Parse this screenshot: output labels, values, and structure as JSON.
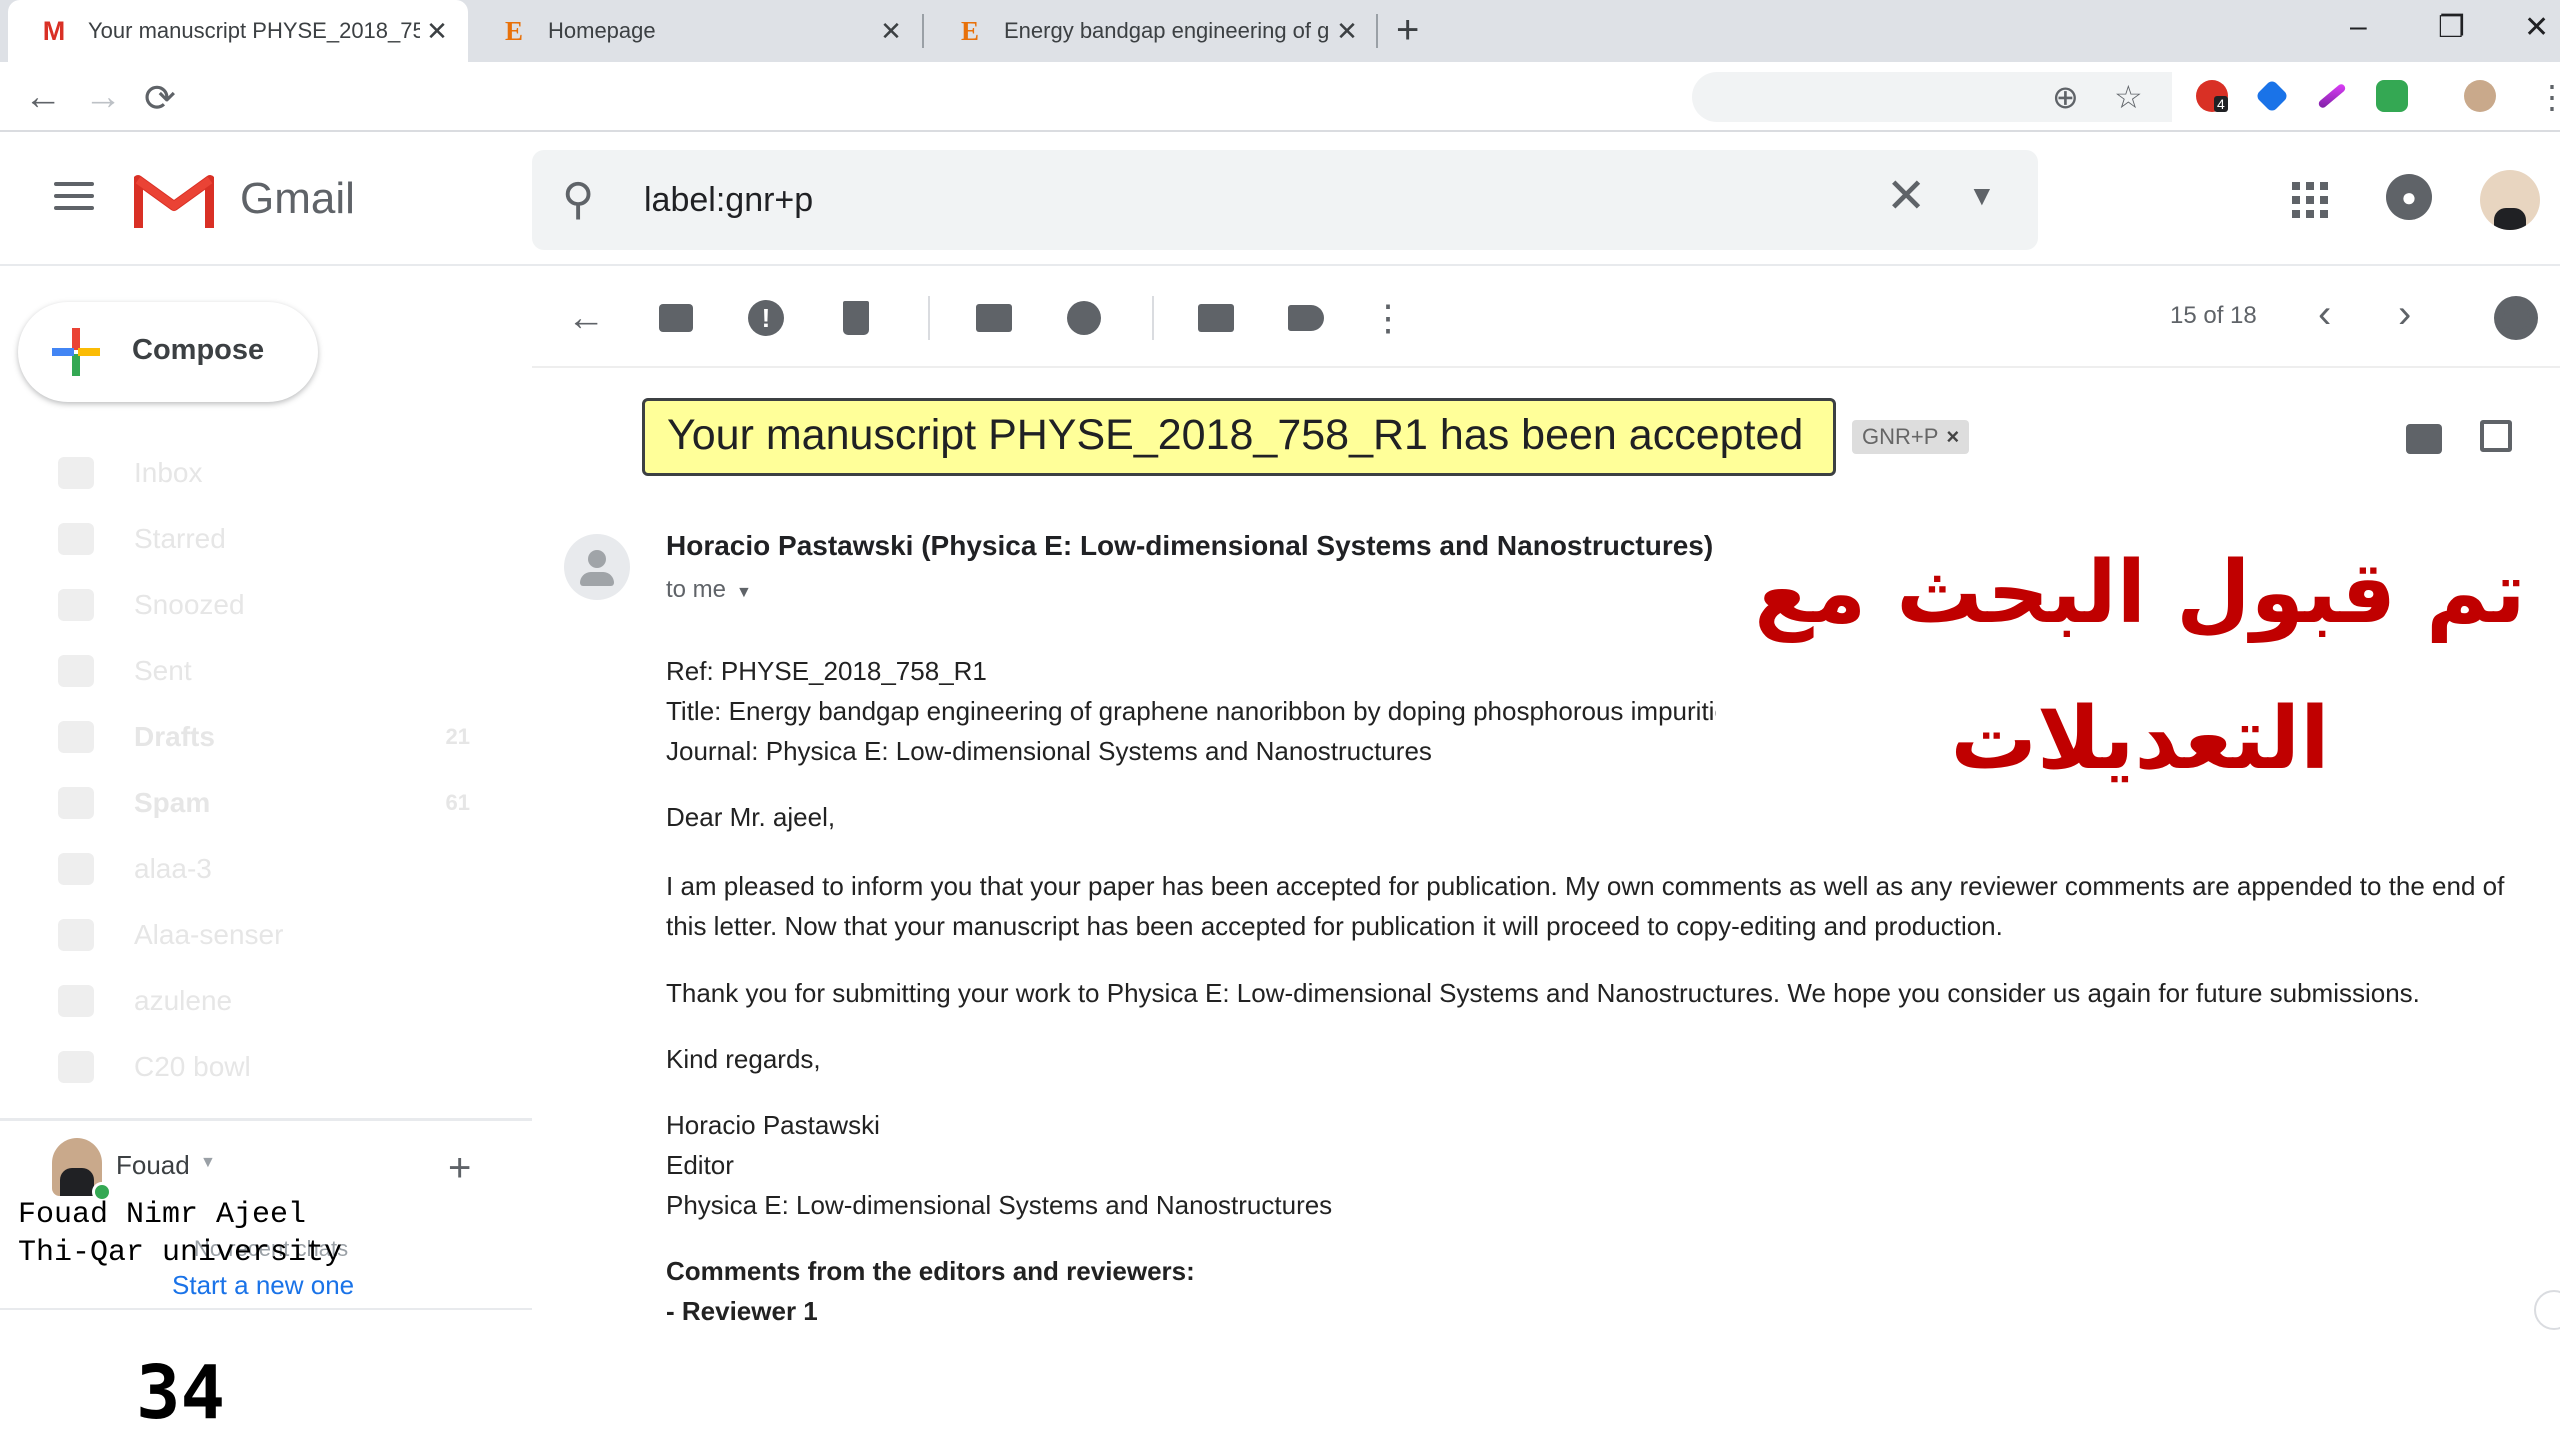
{
  "browser": {
    "tabs": [
      {
        "title": "Your manuscript PHYSE_2018_75",
        "favicon": "M",
        "active": true
      },
      {
        "title": "Homepage",
        "favicon": "E",
        "active": false
      },
      {
        "title": "Energy bandgap engineering of g",
        "favicon": "E",
        "active": false
      }
    ],
    "new_tab": "+",
    "window_controls": {
      "minimize": "–",
      "restore": "❐",
      "close": "✕"
    },
    "nav": {
      "back": "←",
      "forward": "→",
      "reload": "⟳"
    },
    "icons": [
      "zoom-icon",
      "star-icon",
      "extension-icons",
      "profile-icon",
      "menu-icon"
    ],
    "extension_badge": "4"
  },
  "header": {
    "app_name": "Gmail",
    "search": {
      "value": "label:gnr+p"
    }
  },
  "sidebar": {
    "compose_label": "Compose",
    "items": [
      {
        "label": "Inbox",
        "count": "",
        "bold": false
      },
      {
        "label": "Starred",
        "count": "",
        "bold": false
      },
      {
        "label": "Snoozed",
        "count": "",
        "bold": false
      },
      {
        "label": "Sent",
        "count": "",
        "bold": false
      },
      {
        "label": "Drafts",
        "count": "21",
        "bold": true
      },
      {
        "label": "Spam",
        "count": "61",
        "bold": true
      },
      {
        "label": "alaa-3",
        "count": "",
        "bold": false
      },
      {
        "label": "Alaa-senser",
        "count": "",
        "bold": false
      },
      {
        "label": "azulene",
        "count": "",
        "bold": false
      },
      {
        "label": "C20 bowl",
        "count": "",
        "bold": false
      }
    ],
    "hangouts": {
      "user": "Fouad",
      "ghost_text": "No recent chats",
      "start_link": "Start a new one"
    },
    "signature": "Fouad Nimr Ajeel\nThi-Qar university"
  },
  "toolbar": {
    "pager": "15 of 18"
  },
  "message": {
    "subject": "Your manuscript PHYSE_2018_758_R1 has been accepted",
    "label_chip": "GNR+P",
    "sender": "Horacio Pastawski (Physica E: Low-dimensional Systems and Nanostructures)",
    "to": "to me",
    "ref": "Ref: PHYSE_2018_758_R1",
    "title_line": "Title: Energy bandgap engineering of graphene nanoribbon by doping phosphorous impurities",
    "journal_line": "Journal: Physica E: Low-dimensional Systems and Nanostructures",
    "greeting": "Dear Mr. ajeel,",
    "para1": "I am pleased to inform you that your paper has been accepted for publication. My own comments as well as any reviewer comments are appended to the end of this letter. Now that your manuscript has been accepted for publication it will proceed to copy-editing and production.",
    "para2": "Thank you for submitting your work to Physica E: Low-dimensional Systems and Nanostructures. We hope you consider us again for future submissions.",
    "closing": "Kind regards,",
    "sig_name": "Horacio Pastawski",
    "sig_role": "Editor",
    "sig_journal": "Physica E: Low-dimensional Systems and Nanostructures",
    "comments_heading": "Comments from the editors and reviewers:",
    "reviewer": "- Reviewer 1"
  },
  "overlay": {
    "arabic_caption": "تم قبول البحث مع التعديلات",
    "page_number": "34"
  },
  "colors": {
    "subject_highlight": "#ffff99",
    "arabic_text": "#c00000",
    "link": "#1a73e8",
    "chrome_bg": "#dee1e6"
  }
}
